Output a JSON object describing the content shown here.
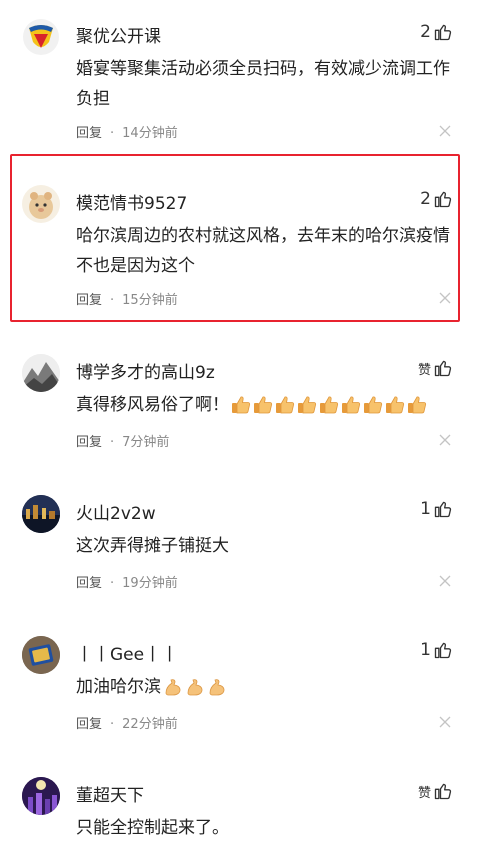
{
  "colors": {
    "highlight": "#e8232f",
    "meta": "#888888",
    "text": "#222222"
  },
  "comments": [
    {
      "username": "聚优公开课",
      "like": "2",
      "text": "婚宴等聚集活动必须全员扫码，有效减少流调工作负担",
      "reply": "回复",
      "time": "14分钟前",
      "avatar": "shield-logo-avatar"
    },
    {
      "username": "模范情书9527",
      "like": "2",
      "text": "哈尔滨周边的农村就这风格，去年末的哈尔滨疫情不也是因为这个",
      "reply": "回复",
      "time": "15分钟前",
      "avatar": "hamster-avatar"
    },
    {
      "username": "博学多才的高山9z",
      "like": "赞",
      "text": "真得移风易俗了啊！",
      "emoji": "thumbs-up-emoji",
      "emoji_count": 9,
      "reply": "回复",
      "time": "7分钟前",
      "avatar": "mountain-painting-avatar"
    },
    {
      "username": "火山2v2w",
      "like": "1",
      "text": "这次弄得摊子铺挺大",
      "reply": "回复",
      "time": "19分钟前",
      "avatar": "night-city-avatar"
    },
    {
      "username": "丨丨Gee丨丨",
      "like": "1",
      "text": "加油哈尔滨",
      "emoji": "flexed-biceps-emoji",
      "emoji_count": 3,
      "reply": "回复",
      "time": "22分钟前",
      "avatar": "book-avatar"
    },
    {
      "username": "董超天下",
      "like": "赞",
      "text": "只能全控制起来了。",
      "reply": "",
      "time": "",
      "avatar": "purple-night-avatar"
    }
  ]
}
